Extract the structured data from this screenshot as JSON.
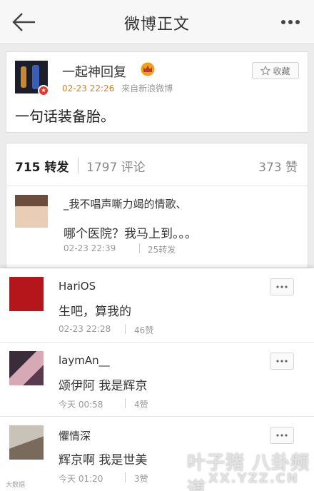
{
  "header": {
    "title": "微博正文"
  },
  "post": {
    "author": "一起神回复",
    "time": "02-23 22:26",
    "source": "来自新浪微博",
    "favorite_label": "收藏",
    "text": "一句话装备胎。"
  },
  "tabs": {
    "repost": "715 转发",
    "comment": "1797 评论",
    "like": "373 赞"
  },
  "repost_item": {
    "user": "_我不唱声嘶力竭的情歌、",
    "text": "哪个医院？我马上到。。。",
    "time": "02-23 22:39",
    "count": "25转发"
  },
  "comments": [
    {
      "user": "HariOS",
      "text": "生吧，算我的",
      "time": "02-23 22:28",
      "likes": "46赞"
    },
    {
      "user": "laymAn__",
      "text": "颂伊阿 我是辉京",
      "time": "今天 00:58",
      "likes": "4赞"
    },
    {
      "user": "懼情深",
      "text": "辉京啊 我是世美",
      "time": "今天 01:20",
      "likes": "3赞"
    }
  ],
  "watermark": {
    "main": "叶子猪 八卦频道",
    "sub": "XX.YZZ.CN",
    "small": "大数据"
  },
  "colors": {
    "accent_orange": "#d97e1f",
    "vip_red": "#e1392b",
    "crown_gold": "#e8a317"
  }
}
